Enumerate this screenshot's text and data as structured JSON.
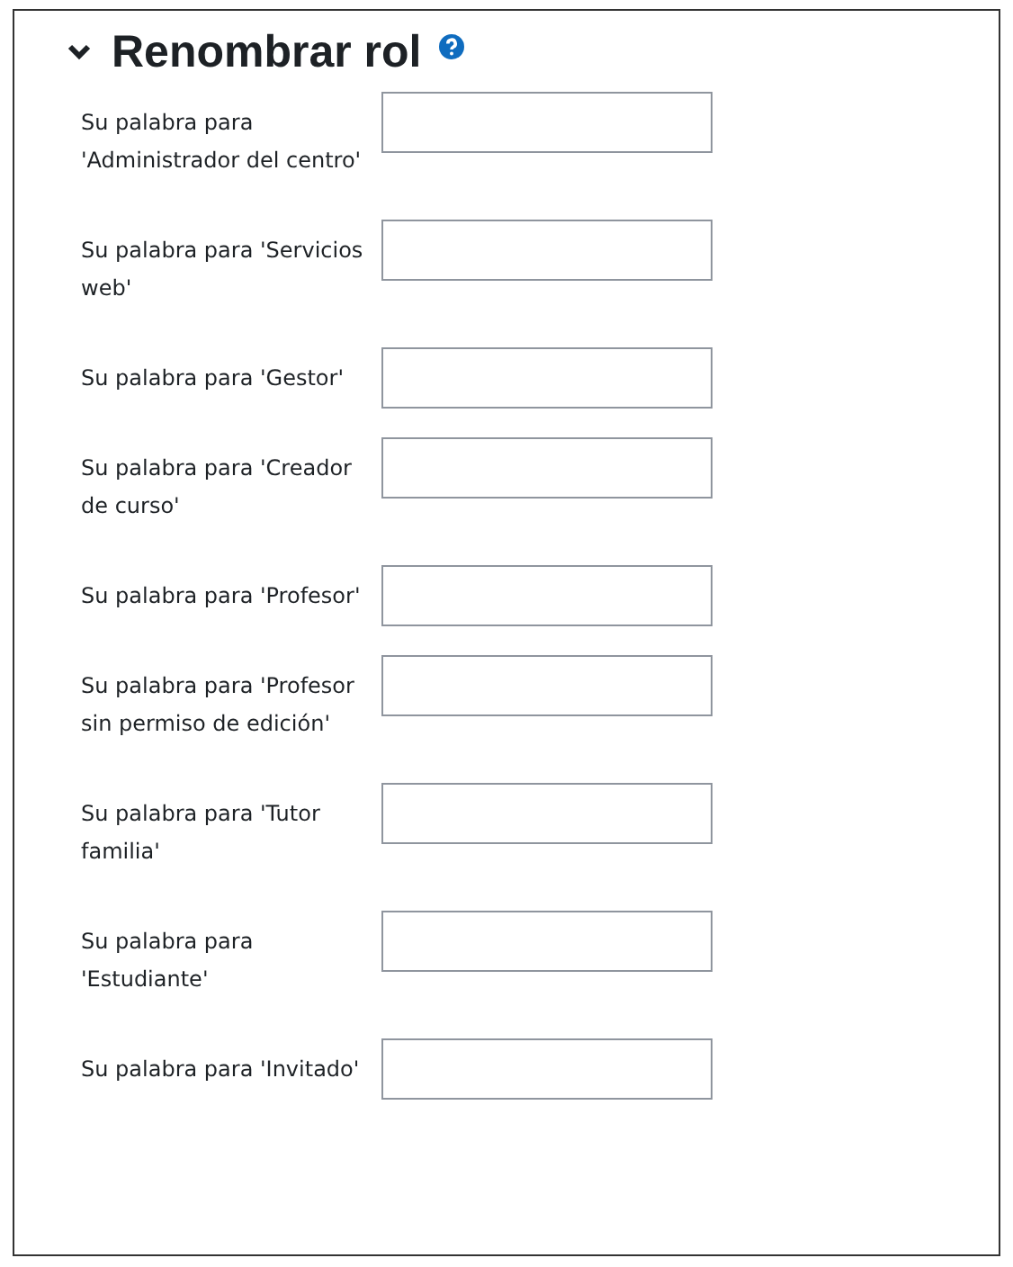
{
  "section": {
    "title": "Renombrar rol",
    "expanded": true
  },
  "fields": [
    {
      "label": "Su palabra para 'Administrador del centro'"
    },
    {
      "label": "Su palabra para 'Servicios web'"
    },
    {
      "label": "Su palabra para 'Gestor'"
    },
    {
      "label": "Su palabra para 'Creador de curso'"
    },
    {
      "label": "Su palabra para 'Profesor'"
    },
    {
      "label": "Su palabra para 'Profesor sin permiso de edición'"
    },
    {
      "label": "Su palabra para 'Tutor familia'"
    },
    {
      "label": "Su palabra para 'Estudiante'"
    },
    {
      "label": "Su palabra para 'Invitado'"
    }
  ]
}
